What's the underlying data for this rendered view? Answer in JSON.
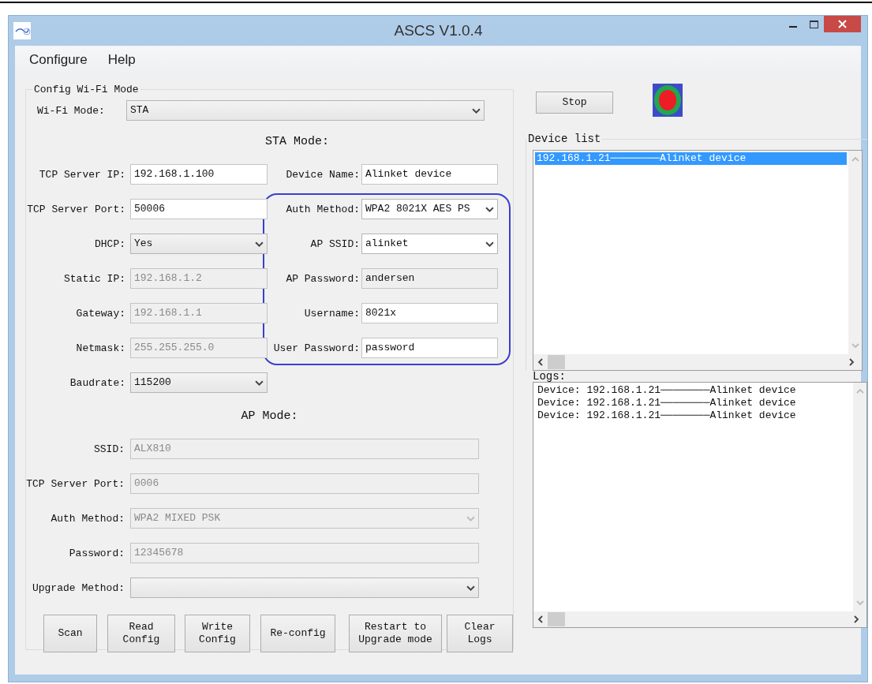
{
  "window": {
    "title": "ASCS V1.0.4"
  },
  "menu": [
    {
      "label": "Configure"
    },
    {
      "label": "Help"
    }
  ],
  "config": {
    "title": "Config Wi-Fi Mode",
    "wifi_mode": {
      "label": "Wi-Fi Mode:",
      "value": "STA",
      "kind": "dropdown",
      "disabled": false
    },
    "sta_heading": "STA Mode:",
    "sta_left": [
      {
        "label": "TCP Server IP:",
        "value": "192.168.1.100",
        "kind": "text",
        "disabled": false
      },
      {
        "label": "TCP Server Port:",
        "value": "50006",
        "kind": "text",
        "disabled": false
      },
      {
        "label": "DHCP:",
        "value": "Yes",
        "kind": "dropdown",
        "disabled": false
      },
      {
        "label": "Static IP:",
        "value": "192.168.1.2",
        "kind": "text",
        "disabled": true
      },
      {
        "label": "Gateway:",
        "value": "192.168.1.1",
        "kind": "text",
        "disabled": true
      },
      {
        "label": "Netmask:",
        "value": "255.255.255.0",
        "kind": "text",
        "disabled": true
      },
      {
        "label": "Baudrate:",
        "value": "115200",
        "kind": "dropdown",
        "disabled": false
      }
    ],
    "sta_right": [
      {
        "label": "Device Name:",
        "value": "Alinket device",
        "kind": "text",
        "disabled": false,
        "circled": false
      },
      {
        "label": "Auth Method:",
        "value": "WPA2 8021X AES PS",
        "kind": "dropdown",
        "disabled": false,
        "circled": true
      },
      {
        "label": "AP SSID:",
        "value": "alinket",
        "kind": "dropdown",
        "disabled": false,
        "circled": true
      },
      {
        "label": "AP Password:",
        "value": "andersen",
        "kind": "readonly",
        "disabled": false,
        "circled": true
      },
      {
        "label": "Username:",
        "value": "8021x",
        "kind": "text",
        "disabled": false,
        "circled": true
      },
      {
        "label": "User Password:",
        "value": "password",
        "kind": "text",
        "disabled": false,
        "circled": true
      }
    ],
    "ap_heading": "AP Mode:",
    "ap_fields": [
      {
        "label": "SSID:",
        "value": "ALX810",
        "kind": "text",
        "disabled": true
      },
      {
        "label": "TCP Server Port:",
        "value": "0006",
        "kind": "text",
        "disabled": true
      },
      {
        "label": "Auth Method:",
        "value": "WPA2 MIXED PSK",
        "kind": "dropdown",
        "disabled": true
      },
      {
        "label": "Password:",
        "value": "12345678",
        "kind": "text",
        "disabled": true
      }
    ],
    "upgrade": {
      "label": "Upgrade Method:",
      "kind": "dropdown",
      "disabled": false
    },
    "buttons": [
      {
        "label": "Scan"
      },
      {
        "label": "Read\nConfig"
      },
      {
        "label": "Write\nConfig"
      },
      {
        "label": "Re-config"
      },
      {
        "label": "Restart to\nUpgrade mode"
      },
      {
        "label": "Clear\nLogs"
      }
    ]
  },
  "stop_button": {
    "label": "Stop"
  },
  "device_list": {
    "title": "Device list",
    "items": [
      {
        "text": "192.168.1.21────────Alinket device",
        "selected": true
      }
    ]
  },
  "logs": {
    "label": "Logs:",
    "lines": [
      "Device: 192.168.1.21────────Alinket device",
      "Device: 192.168.1.21────────Alinket device",
      "Device: 192.168.1.21────────Alinket device"
    ]
  }
}
